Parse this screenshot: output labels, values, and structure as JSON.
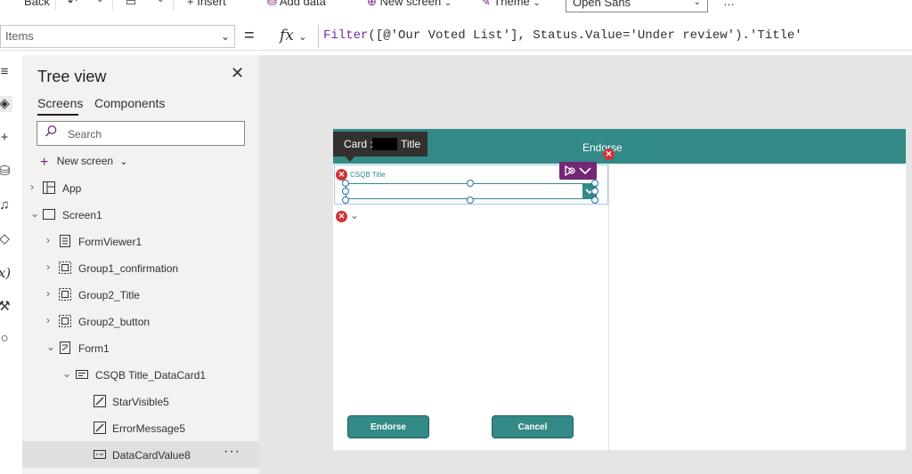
{
  "command_bar": {
    "back": "Back",
    "insert": "Insert",
    "add_data": "Add data",
    "new_screen": "New screen",
    "theme": "Theme",
    "font": "Open Sans",
    "more": "…"
  },
  "formula_bar": {
    "property": "Items",
    "equals": "=",
    "fx": "fx",
    "formula_fn": "Filter",
    "formula_rest": "([@'Our Voted List'], Status.Value='Under review').'Title'"
  },
  "tree": {
    "title": "Tree view",
    "tabs": [
      "Screens",
      "Components"
    ],
    "search_placeholder": "Search",
    "new_screen": "New screen",
    "items": [
      {
        "label": "App"
      },
      {
        "label": "Screen1"
      },
      {
        "label": "FormViewer1"
      },
      {
        "label": "Group1_confirmation"
      },
      {
        "label": "Group2_Title"
      },
      {
        "label": "Group2_button"
      },
      {
        "label": "Form1"
      },
      {
        "label": "CSQB Title_DataCard1"
      },
      {
        "label": "StarVisible5"
      },
      {
        "label": "ErrorMessage5"
      },
      {
        "label": "DataCardValue8"
      }
    ],
    "more": "···"
  },
  "canvas": {
    "header_title": "Endorse .",
    "tooltip_prefix": "Card :",
    "tooltip_suffix": "Title",
    "card_label": "CSQB Title",
    "endorse_button": "Endorse",
    "cancel_button": "Cancel"
  },
  "colors": {
    "accent": "#338a87",
    "error": "#d13438",
    "badge": "#742774"
  }
}
